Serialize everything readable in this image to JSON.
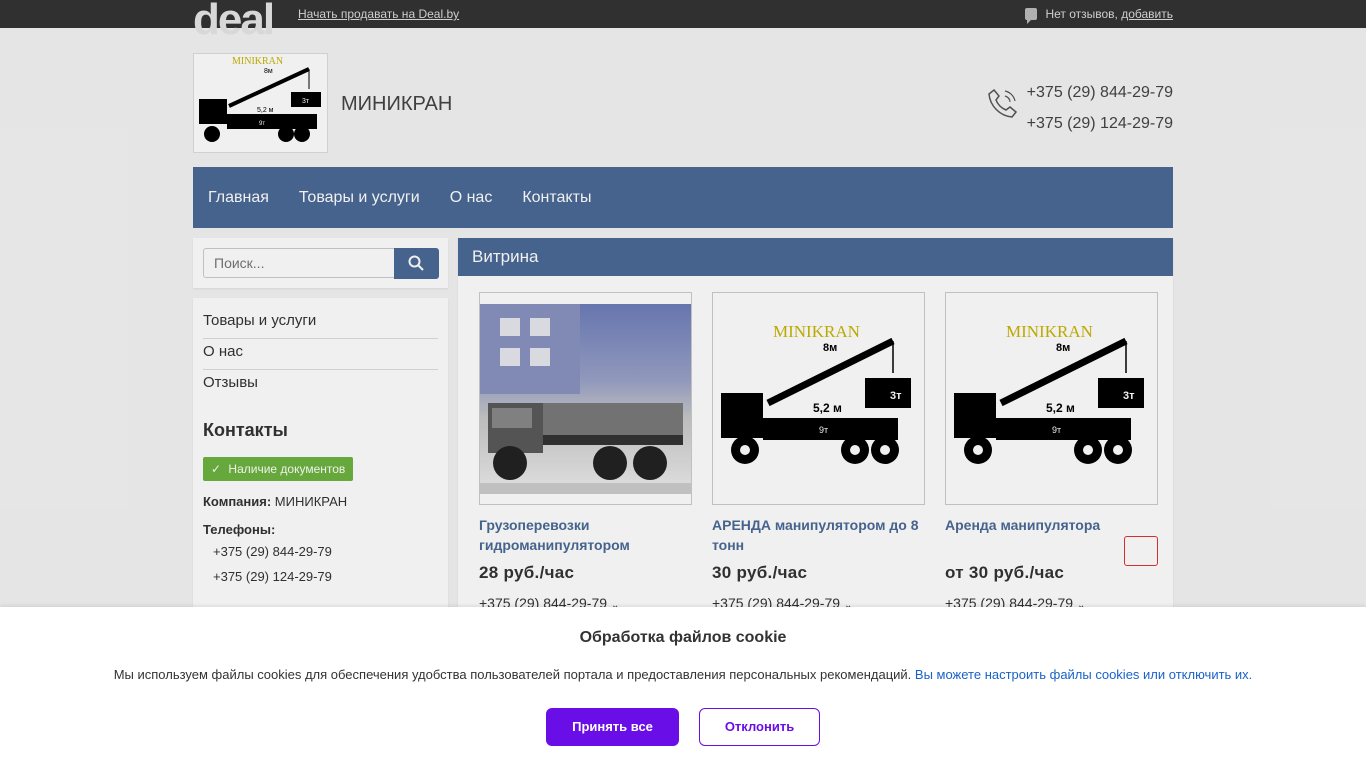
{
  "topbar": {
    "logo": "deal",
    "sell_link": "Начать продавать на Deal.by",
    "reviews_text": "Нет отзывов,",
    "reviews_add": "добавить"
  },
  "header": {
    "company": "МИНИКРАН",
    "phones": [
      "+375 (29) 844-29-79",
      "+375 (29) 124-29-79"
    ],
    "logo_image": {
      "brand": "MINIKRAN",
      "height": "8м",
      "load": "3т",
      "reach": "5,2 м",
      "capacity": "9т"
    }
  },
  "nav": [
    "Главная",
    "Товары и услуги",
    "О нас",
    "Контакты"
  ],
  "search": {
    "placeholder": "Поиск..."
  },
  "sidebar": {
    "menu": [
      "Товары и услуги",
      "О нас",
      "Отзывы"
    ],
    "contacts_title": "Контакты",
    "doc_badge": "Наличие документов",
    "company_label": "Компания:",
    "company_value": "МИНИКРАН",
    "phones_label": "Телефоны:",
    "phones": [
      "+375 (29) 844-29-79",
      "+375 (29) 124-29-79"
    ]
  },
  "main": {
    "title": "Витрина",
    "products": [
      {
        "title": "Грузоперевозки гидроманипулятором",
        "price": "28 руб./час",
        "phone": "+375 (29) 844-29-79"
      },
      {
        "title": "АРЕНДА манипулятором до 8 тонн",
        "price": "30 руб./час",
        "phone": "+375 (29) 844-29-79"
      },
      {
        "title": "Аренда манипулятора",
        "price": "от 30 руб./час",
        "phone": "+375 (29) 844-29-79"
      }
    ]
  },
  "cookie": {
    "title": "Обработка файлов cookie",
    "text": "Мы используем файлы cookies для обеспечения удобства пользователей портала и предоставления персональных рекомендаций.",
    "link": "Вы можете настроить файлы cookies или отключить их.",
    "accept": "Принять все",
    "decline": "Отклонить"
  },
  "colors": {
    "brand_blue": "#4b6a96",
    "accent_purple": "#6a0ee8",
    "badge_green": "#6db33f"
  }
}
